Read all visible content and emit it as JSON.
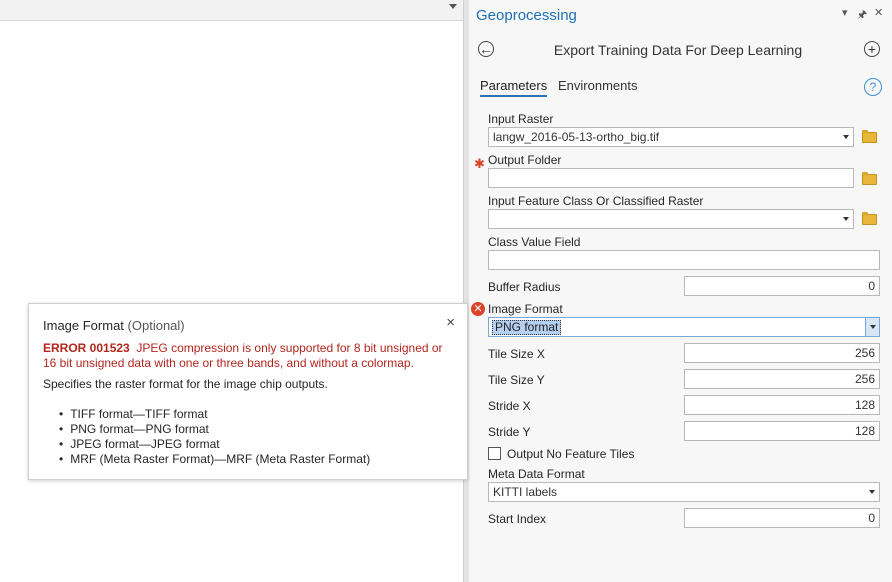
{
  "panel": {
    "title": "Geoprocessing",
    "header_icons": [
      "dropdown-icon",
      "pin-icon",
      "close-icon"
    ],
    "tool_title": "Export Training Data For Deep Learning",
    "tabs": [
      "Parameters",
      "Environments"
    ],
    "help_glyph": "?"
  },
  "params": {
    "input_raster": {
      "label": "Input Raster",
      "value": "langw_2016-05-13-ortho_big.tif"
    },
    "output_folder": {
      "label": "Output Folder",
      "value": ""
    },
    "input_feature": {
      "label": "Input Feature Class Or Classified Raster",
      "value": ""
    },
    "class_value": {
      "label": "Class Value Field",
      "value": ""
    },
    "buffer_radius": {
      "label": "Buffer Radius",
      "value": "0"
    },
    "image_format": {
      "label": "Image Format",
      "value": "PNG format"
    },
    "tile_size_x": {
      "label": "Tile Size X",
      "value": "256"
    },
    "tile_size_y": {
      "label": "Tile Size Y",
      "value": "256"
    },
    "stride_x": {
      "label": "Stride X",
      "value": "128"
    },
    "stride_y": {
      "label": "Stride Y",
      "value": "128"
    },
    "output_no_feature": {
      "label": "Output No Feature Tiles",
      "checked": false
    },
    "meta_data_format": {
      "label": "Meta Data Format",
      "value": "KITTI labels"
    },
    "start_index": {
      "label": "Start Index",
      "value": "0"
    }
  },
  "tooltip": {
    "title": "Image Format",
    "optional": "(Optional)",
    "close": "×",
    "error_code": "ERROR 001523",
    "error_text": "JPEG compression is only supported for 8 bit unsigned or 16 bit unsigned data with one or three bands, and without a colormap.",
    "description": "Specifies the raster format for the image chip outputs.",
    "options": [
      "TIFF format—TIFF format",
      "PNG format—PNG format",
      "JPEG format—JPEG format",
      "MRF (Meta Raster Format)—MRF (Meta Raster Format)"
    ]
  },
  "colors": {
    "accent": "#1f6fb5",
    "error": "#b3261e",
    "selection": "#b4cfef"
  }
}
